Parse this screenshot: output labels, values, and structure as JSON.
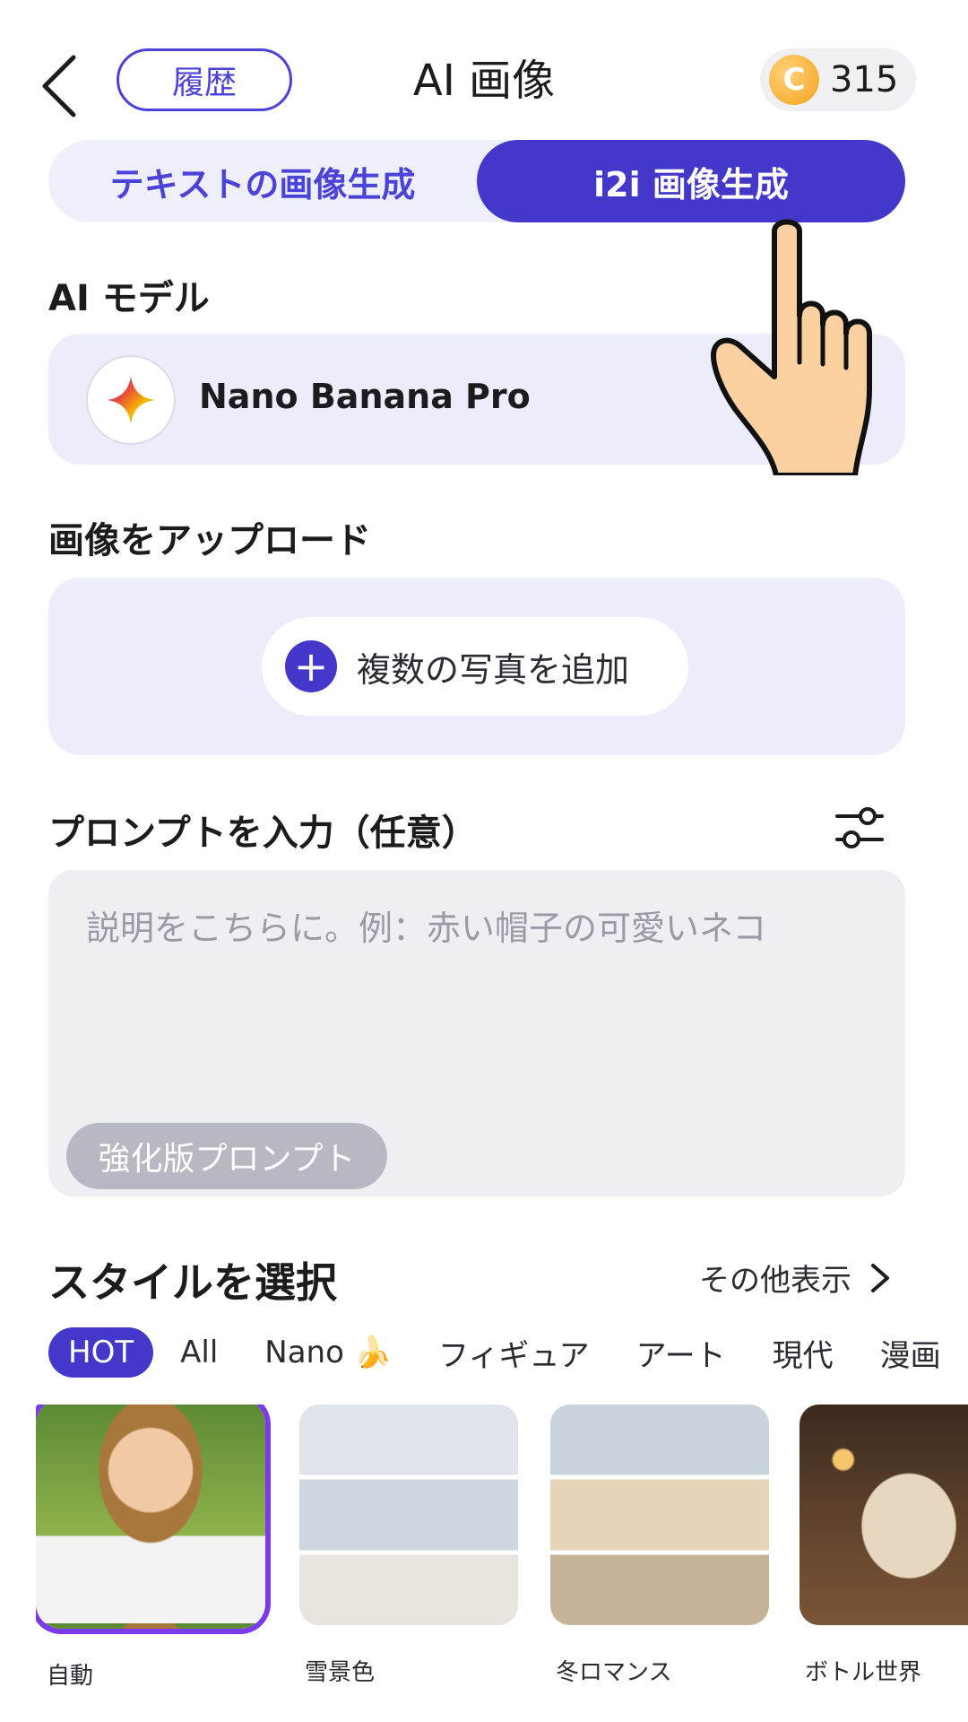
{
  "header": {
    "history_label": "履歴",
    "title": "AI 画像",
    "coin_symbol": "C",
    "coin_balance": "315"
  },
  "mode_tabs": [
    {
      "label": "テキストの画像生成",
      "active": false
    },
    {
      "label": "i2i 画像生成",
      "active": true
    }
  ],
  "model_section": {
    "label": "AI モデル",
    "model_name": "Nano Banana Pro"
  },
  "upload_section": {
    "label": "画像をアップロード",
    "button_label": "複数の写真を追加"
  },
  "prompt_section": {
    "label": "プロンプトを入力（任意）",
    "placeholder": "説明をこちらに。例：赤い帽子の可愛いネコ",
    "enhance_label": "強化版プロンプト"
  },
  "style_section": {
    "title": "スタイルを選択",
    "more_label": "その他表示",
    "tabs": [
      "HOT",
      "All",
      "Nano 🍌",
      "フィギュア",
      "アート",
      "現代",
      "漫画"
    ],
    "items": [
      {
        "label": "自動",
        "selected": true
      },
      {
        "label": "雪景色",
        "selected": false
      },
      {
        "label": "冬ロマンス",
        "selected": false
      },
      {
        "label": "ボトル世界",
        "selected": false
      }
    ]
  },
  "colors": {
    "accent": "#4338ca",
    "accent_light": "#ececfa",
    "coin": "#f4a21c"
  }
}
